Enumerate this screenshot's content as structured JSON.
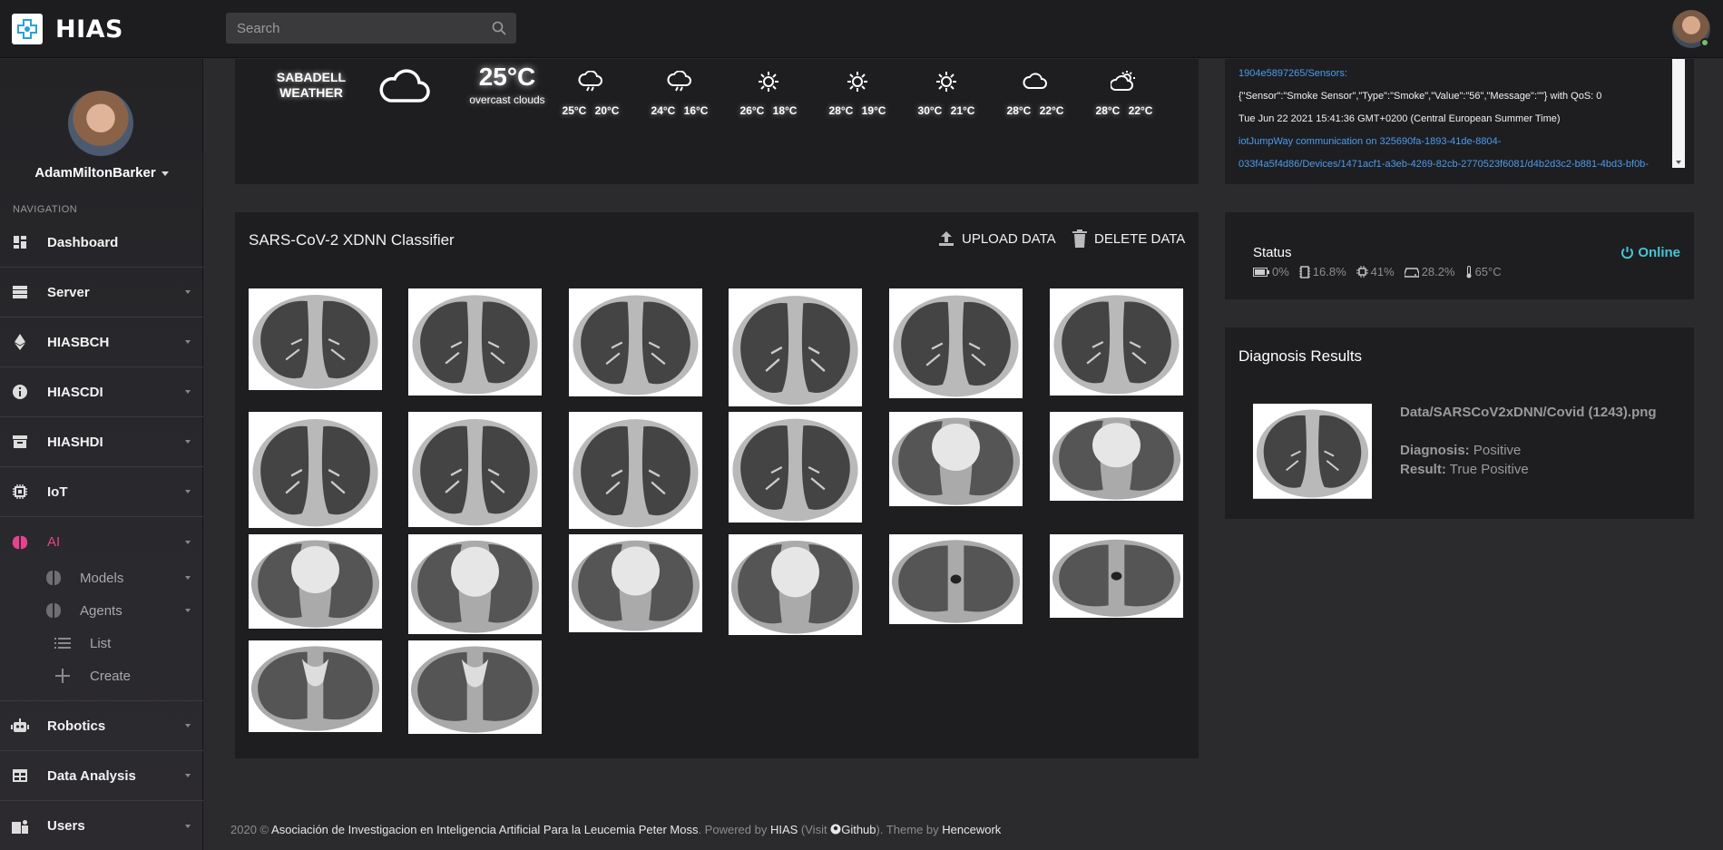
{
  "brand": {
    "name": "HIAS"
  },
  "search": {
    "placeholder": "Search"
  },
  "sidebar": {
    "user_name": "AdamMiltonBarker",
    "nav_heading": "NAVIGATION",
    "items": [
      {
        "label": "Dashboard",
        "icon": "dashboard-icon"
      },
      {
        "label": "Server",
        "icon": "server-icon"
      },
      {
        "label": "HIASBCH",
        "icon": "ethereum-icon"
      },
      {
        "label": "HIASCDI",
        "icon": "info-icon"
      },
      {
        "label": "HIASHDI",
        "icon": "archive-icon"
      },
      {
        "label": "IoT",
        "icon": "chip-icon"
      },
      {
        "label": "AI",
        "icon": "brain-icon"
      },
      {
        "label": "Robotics",
        "icon": "robot-icon"
      },
      {
        "label": "Data Analysis",
        "icon": "table-icon"
      },
      {
        "label": "Users",
        "icon": "users-icon"
      }
    ],
    "ai_sub": [
      {
        "label": "Models"
      },
      {
        "label": "Agents"
      },
      {
        "label": "List"
      },
      {
        "label": "Create"
      }
    ]
  },
  "weather": {
    "city_line1": "SABADELL",
    "city_line2": "WEATHER",
    "temp": "25°C",
    "desc": "overcast clouds",
    "forecast": [
      {
        "icon": "rain-icon",
        "temps": "25°C 20°C"
      },
      {
        "icon": "rain-icon",
        "temps": "24°C 16°C"
      },
      {
        "icon": "sun-icon",
        "temps": "26°C 18°C"
      },
      {
        "icon": "sun-icon",
        "temps": "28°C 19°C"
      },
      {
        "icon": "sun-icon",
        "temps": "30°C 21°C"
      },
      {
        "icon": "cloud-icon",
        "temps": "28°C 22°C"
      },
      {
        "icon": "partly-cloudy-icon",
        "temps": "28°C 22°C"
      }
    ]
  },
  "log": {
    "lines": [
      {
        "text": "1904e5897265/Sensors:",
        "kind": "link"
      },
      {
        "text": "{\"Sensor\":\"Smoke Sensor\",\"Type\":\"Smoke\",\"Value\":\"56\",\"Message\":\"\"} with QoS: 0",
        "kind": "plain"
      },
      {
        "text": "Tue Jun 22 2021 15:41:36 GMT+0200 (Central European Summer Time)",
        "kind": "plain"
      },
      {
        "text": "iotJumpWay communication on 325690fa-1893-41de-8804-",
        "kind": "link"
      },
      {
        "text": "033f4a5f4d86/Devices/1471acf1-a3eb-4269-82cb-2770523f6081/d4b2d3c2-b881-4bd3-bf0b-",
        "kind": "link"
      }
    ]
  },
  "classifier": {
    "title": "SARS-CoV-2 XDNN Classifier",
    "upload_label": "UPLOAD DATA",
    "delete_label": "DELETE DATA"
  },
  "status": {
    "title": "Status",
    "online": "Online",
    "battery": "0%",
    "memory": "16.8%",
    "cpu": "41%",
    "disk": "28.2%",
    "temperature": "65°C"
  },
  "diagnosis": {
    "title": "Diagnosis Results",
    "file": "Data/SARSCoV2xDNN/Covid (1243).png",
    "diagnosis_label": "Diagnosis:",
    "diagnosis_value": "Positive",
    "result_label": "Result:",
    "result_value": "True Positive"
  },
  "footer": {
    "year": "2020 ©",
    "org": "Asociación de Investigacion en Inteligencia Artificial Para la Leucemia Peter Moss",
    "powered": ". Powered by",
    "hias": "HIAS",
    "visit": "(Visit",
    "github": "Github",
    "theme": "). Theme by",
    "hencework": "Hencework"
  }
}
